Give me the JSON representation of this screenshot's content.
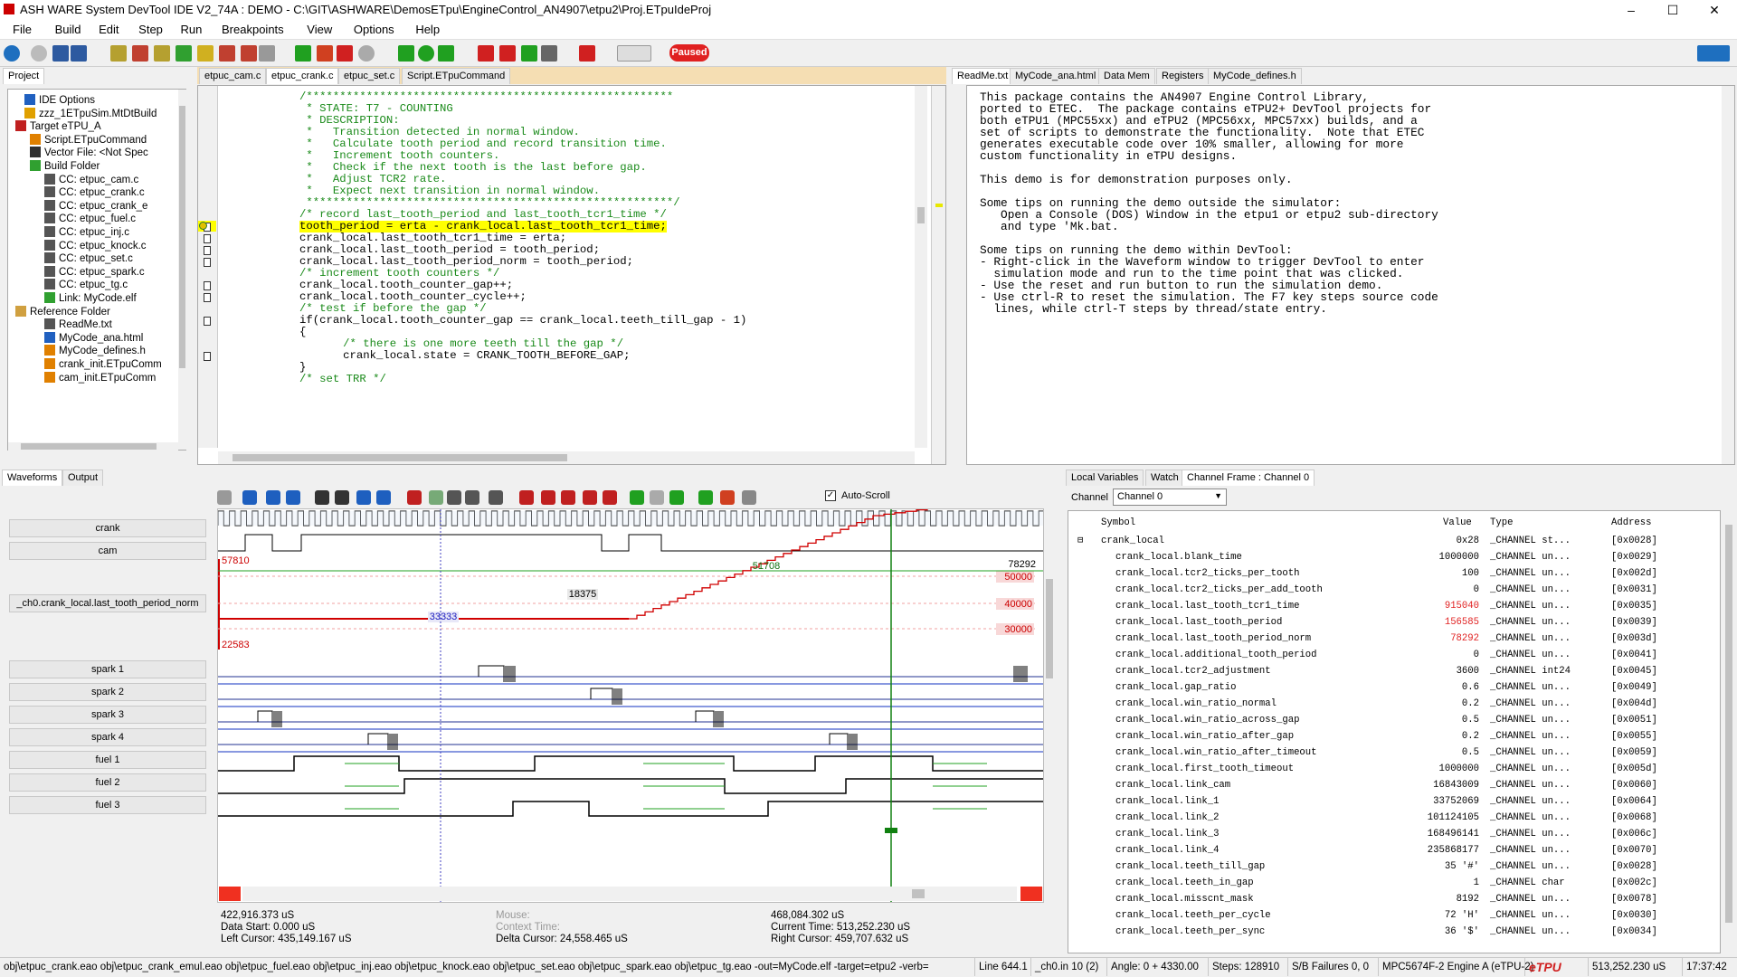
{
  "window": {
    "title": "ASH WARE System DevTool IDE V2_74A : DEMO - C:\\GIT\\ASHWARE\\DemosETpu\\EngineControl_AN4907\\etpu2\\Proj.ETpuIdeProj",
    "minimize": "–",
    "maximize": "☐",
    "close": "✕"
  },
  "menu": [
    "File",
    "Build",
    "Edit",
    "Step",
    "Run",
    "Breakpoints",
    "View",
    "Options",
    "Help"
  ],
  "toolbar": {
    "status_badge": "Paused"
  },
  "project": {
    "tab": "Project",
    "items": [
      "IDE Options",
      "zzz_1ETpuSim.MtDtBuild",
      "Target eTPU_A",
      "Script.ETpuCommand",
      "Vector File: <Not Spec",
      "Build Folder",
      "CC: etpuc_cam.c",
      "CC: etpuc_crank.c",
      "CC: etpuc_crank_e",
      "CC: etpuc_fuel.c",
      "CC: etpuc_inj.c",
      "CC: etpuc_knock.c",
      "CC: etpuc_set.c",
      "CC: etpuc_spark.c",
      "CC: etpuc_tg.c",
      "Link: MyCode.elf",
      "Reference Folder",
      "ReadMe.txt",
      "MyCode_ana.html",
      "MyCode_defines.h",
      "crank_init.ETpuComm",
      "cam_init.ETpuComm"
    ]
  },
  "editor": {
    "tabs": [
      "etpuc_cam.c",
      "etpuc_crank.c",
      "etpuc_set.c",
      "Script.ETpuCommand"
    ],
    "lines": [
      "/*******************************************************",
      " * STATE: T7 - COUNTING",
      " * DESCRIPTION:",
      " *   Transition detected in normal window.",
      " *   Calculate tooth period and record transition time.",
      " *   Increment tooth counters.",
      " *   Check if the next tooth is the last before gap.",
      " *   Adjust TCR2 rate.",
      " *   Expect next transition in normal window.",
      " *******************************************************/",
      "/* record last_tooth_period and last_tooth_tcr1_time */",
      "tooth_period = erta - crank_local.last_tooth_tcr1_time;",
      "crank_local.last_tooth_tcr1_time = erta;",
      "crank_local.last_tooth_period = tooth_period;",
      "crank_local.last_tooth_period_norm = tooth_period;",
      "/* increment tooth counters */",
      "crank_local.tooth_counter_gap++;",
      "crank_local.tooth_counter_cycle++;",
      "/* test if before the gap */",
      "if(crank_local.tooth_counter_gap == crank_local.teeth_till_gap - 1)",
      "{",
      "   /* there is one more teeth till the gap */",
      "   crank_local.state = CRANK_TOOTH_BEFORE_GAP;",
      "}",
      "/* set TRR */"
    ]
  },
  "readme": {
    "tabs": [
      "ReadMe.txt",
      "MyCode_ana.html",
      "Data Mem",
      "Registers",
      "MyCode_defines.h"
    ],
    "lines": [
      "This package contains the AN4907 Engine Control Library,",
      "ported to ETEC.  The package contains eTPU2+ DevTool projects for",
      "both eTPU1 (MPC55xx) and eTPU2 (MPC56xx, MPC57xx) builds, and a",
      "set of scripts to demonstrate the functionality.  Note that ETEC",
      "generates executable code over 10% smaller, allowing for more",
      "custom functionality in eTPU designs.",
      "",
      "This demo is for demonstration purposes only.",
      "",
      "Some tips on running the demo outside the simulator:",
      "   Open a Console (DOS) Window in the etpu1 or etpu2 sub-directory",
      "   and type 'Mk.bat.",
      "",
      "Some tips on running the demo within DevTool:",
      "- Right-click in the Waveform window to trigger DevTool to enter",
      "  simulation mode and run to the time point that was clicked.",
      "- Use the reset and run button to run the simulation demo.",
      "- Use ctrl-R to reset the simulation. The F7 key steps source code",
      "  lines, while ctrl-T steps by thread/state entry."
    ]
  },
  "waveforms": {
    "tabs": [
      "Waveforms",
      "Output"
    ],
    "autoscroll": "Auto-Scroll",
    "signals": [
      "crank",
      "cam",
      "_ch0.crank_local.last_tooth_period_norm",
      "spark 1",
      "spark 2",
      "spark 3",
      "spark 4",
      "fuel 1",
      "fuel 2",
      "fuel 3"
    ],
    "analog": {
      "max": "57810",
      "min": "22583",
      "cursor_value": "33333",
      "right_cursor_value": "51708",
      "end_value": "78292",
      "delta": "18375",
      "grid": [
        "50000",
        "40000",
        "30000"
      ]
    },
    "footer": {
      "left_time": "422,916.373 uS",
      "data_start": "Data Start:  0.000 uS",
      "left_cursor": "Left Cursor:  435,149.167 uS",
      "mouse": "Mouse:",
      "context_time": "Context Time:",
      "delta_cursor": "Delta Cursor:  24,558.465 uS",
      "right_time": "468,084.302 uS",
      "current_time": "Current Time:  513,252.230 uS",
      "right_cursor": "Right Cursor:  459,707.632 uS"
    }
  },
  "variables": {
    "tabs": [
      "Local Variables",
      "Watch",
      "Channel Frame : Channel 0"
    ],
    "channel_label": "Channel",
    "channel_value": "Channel 0",
    "headers": [
      "Symbol",
      "Value",
      "Type",
      "Address"
    ],
    "rows": [
      {
        "sym": "crank_local",
        "val": "0x28",
        "type": "_CHANNEL st...",
        "addr": "[0x0028]",
        "red": false,
        "top": true
      },
      {
        "sym": "crank_local.blank_time",
        "val": "1000000",
        "type": "_CHANNEL un...",
        "addr": "[0x0029]",
        "red": false
      },
      {
        "sym": "crank_local.tcr2_ticks_per_tooth",
        "val": "100",
        "type": "_CHANNEL un...",
        "addr": "[0x002d]",
        "red": false
      },
      {
        "sym": "crank_local.tcr2_ticks_per_add_tooth",
        "val": "0",
        "type": "_CHANNEL un...",
        "addr": "[0x0031]",
        "red": false
      },
      {
        "sym": "crank_local.last_tooth_tcr1_time",
        "val": "915040",
        "type": "_CHANNEL un...",
        "addr": "[0x0035]",
        "red": true
      },
      {
        "sym": "crank_local.last_tooth_period",
        "val": "156585",
        "type": "_CHANNEL un...",
        "addr": "[0x0039]",
        "red": true
      },
      {
        "sym": "crank_local.last_tooth_period_norm",
        "val": "78292",
        "type": "_CHANNEL un...",
        "addr": "[0x003d]",
        "red": true
      },
      {
        "sym": "crank_local.additional_tooth_period",
        "val": "0",
        "type": "_CHANNEL un...",
        "addr": "[0x0041]",
        "red": false
      },
      {
        "sym": "crank_local.tcr2_adjustment",
        "val": "3600",
        "type": "_CHANNEL int24",
        "addr": "[0x0045]",
        "red": false
      },
      {
        "sym": "crank_local.gap_ratio",
        "val": "0.6",
        "type": "_CHANNEL un...",
        "addr": "[0x0049]",
        "red": false
      },
      {
        "sym": "crank_local.win_ratio_normal",
        "val": "0.2",
        "type": "_CHANNEL un...",
        "addr": "[0x004d]",
        "red": false
      },
      {
        "sym": "crank_local.win_ratio_across_gap",
        "val": "0.5",
        "type": "_CHANNEL un...",
        "addr": "[0x0051]",
        "red": false
      },
      {
        "sym": "crank_local.win_ratio_after_gap",
        "val": "0.2",
        "type": "_CHANNEL un...",
        "addr": "[0x0055]",
        "red": false
      },
      {
        "sym": "crank_local.win_ratio_after_timeout",
        "val": "0.5",
        "type": "_CHANNEL un...",
        "addr": "[0x0059]",
        "red": false
      },
      {
        "sym": "crank_local.first_tooth_timeout",
        "val": "1000000",
        "type": "_CHANNEL un...",
        "addr": "[0x005d]",
        "red": false
      },
      {
        "sym": "crank_local.link_cam",
        "val": "16843009",
        "type": "_CHANNEL un...",
        "addr": "[0x0060]",
        "red": false
      },
      {
        "sym": "crank_local.link_1",
        "val": "33752069",
        "type": "_CHANNEL un...",
        "addr": "[0x0064]",
        "red": false
      },
      {
        "sym": "crank_local.link_2",
        "val": "101124105",
        "type": "_CHANNEL un...",
        "addr": "[0x0068]",
        "red": false
      },
      {
        "sym": "crank_local.link_3",
        "val": "168496141",
        "type": "_CHANNEL un...",
        "addr": "[0x006c]",
        "red": false
      },
      {
        "sym": "crank_local.link_4",
        "val": "235868177",
        "type": "_CHANNEL un...",
        "addr": "[0x0070]",
        "red": false
      },
      {
        "sym": "crank_local.teeth_till_gap",
        "val": "35 '#'",
        "type": "_CHANNEL un...",
        "addr": "[0x0028]",
        "red": false
      },
      {
        "sym": "crank_local.teeth_in_gap",
        "val": "1",
        "type": "_CHANNEL char",
        "addr": "[0x002c]",
        "red": false
      },
      {
        "sym": "crank_local.misscnt_mask",
        "val": "8192",
        "type": "_CHANNEL un...",
        "addr": "[0x0078]",
        "red": false
      },
      {
        "sym": "crank_local.teeth_per_cycle",
        "val": "72 'H'",
        "type": "_CHANNEL un...",
        "addr": "[0x0030]",
        "red": false
      },
      {
        "sym": "crank_local.teeth_per_sync",
        "val": "36 '$'",
        "type": "_CHANNEL un...",
        "addr": "[0x0034]",
        "red": false
      }
    ]
  },
  "statusbar": {
    "build": "obj\\etpuc_crank.eao obj\\etpuc_crank_emul.eao obj\\etpuc_fuel.eao obj\\etpuc_inj.eao obj\\etpuc_knock.eao obj\\etpuc_set.eao obj\\etpuc_spark.eao obj\\etpuc_tg.eao -out=MyCode.elf -target=etpu2 -verb=",
    "line": "Line 644.1",
    "chan": "_ch0.in 10 (2)",
    "angle": "Angle: 0 + 4330.00",
    "steps": "Steps: 128910",
    "failures": "S/B Failures 0, 0",
    "target": "MPC5674F-2 Engine A (eTPU-2)",
    "logo": "eTPU",
    "time": "513,252.230 uS",
    "clock": "17:37:42"
  }
}
